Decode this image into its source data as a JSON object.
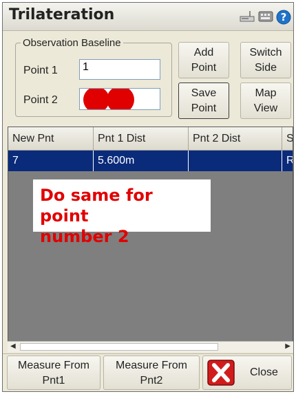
{
  "window": {
    "title": "Trilateration"
  },
  "titlebar_icons": [
    "network-icon",
    "keyboard-icon",
    "help-icon"
  ],
  "baseline": {
    "legend": "Observation Baseline",
    "point1_label": "Point 1",
    "point1_value": "1",
    "point2_label": "Point 2",
    "point2_value": ""
  },
  "buttons": {
    "add_point": [
      "Add",
      "Point"
    ],
    "switch_side": [
      "Switch",
      "Side"
    ],
    "save_point": [
      "Save",
      "Point"
    ],
    "map_view": [
      "Map",
      "View"
    ]
  },
  "table": {
    "columns": [
      "New Pnt",
      "Pnt 1 Dist",
      "Pnt 2 Dist",
      "Si"
    ],
    "rows": [
      [
        "7",
        "5.600m",
        "",
        "Ri"
      ]
    ]
  },
  "annotation": {
    "line1": "Do same for point",
    "line2": "number 2"
  },
  "bottom": {
    "measure1": [
      "Measure From",
      "Pnt1"
    ],
    "measure2": [
      "Measure From",
      "Pnt2"
    ],
    "close": "Close"
  },
  "colors": {
    "selection": "#0a2a7a",
    "annotation_text": "#e10000",
    "redaction": "#e00000"
  }
}
